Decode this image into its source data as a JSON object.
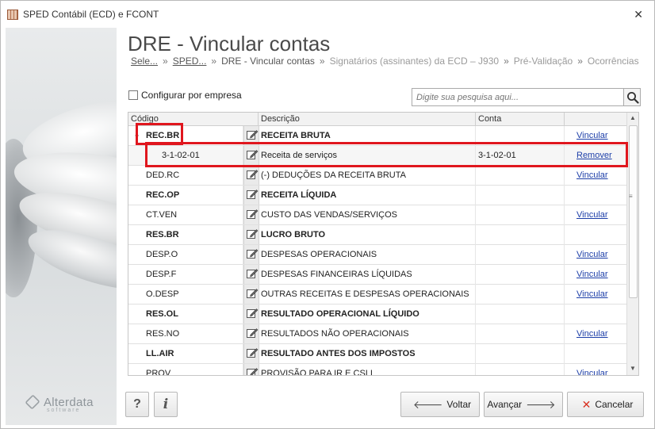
{
  "window": {
    "title": "SPED Contábil (ECD) e FCONT",
    "close_symbol": "✕"
  },
  "brand": {
    "name": "Alterdata",
    "tagline": "software"
  },
  "header": {
    "title": "DRE - Vincular contas",
    "breadcrumb": [
      {
        "label": "Sele...",
        "state": "link"
      },
      {
        "label": "SPED...",
        "state": "link"
      },
      {
        "label": "DRE - Vincular contas",
        "state": "current"
      },
      {
        "label": "Signatários (assinantes) da ECD – J930",
        "state": "future"
      },
      {
        "label": "Pré-Validação",
        "state": "future"
      },
      {
        "label": "Ocorrências",
        "state": "future"
      }
    ],
    "separator": "»"
  },
  "toolbar": {
    "config_checkbox_label": "Configurar por empresa",
    "config_checked": false,
    "search_placeholder": "Digite sua pesquisa aqui..."
  },
  "grid": {
    "columns": {
      "code": "Código",
      "description": "Descrição",
      "account": "Conta"
    },
    "rows": [
      {
        "code": "REC.BR",
        "description": "RECEITA BRUTA",
        "account": "",
        "action": "Vincular",
        "bold": true,
        "expanded": true,
        "expand_symbol": "⌄"
      },
      {
        "code": "3-1-02-01",
        "description": "Receita de serviços",
        "account": "3-1-02-01",
        "action": "Remover",
        "bold": false,
        "sub": true
      },
      {
        "code": "DED.RC",
        "description": "(-) DEDUÇÕES DA RECEITA BRUTA",
        "account": "",
        "action": "Vincular",
        "bold": false
      },
      {
        "code": "REC.OP",
        "description": "RECEITA LÍQUIDA",
        "account": "",
        "action": "",
        "bold": true
      },
      {
        "code": "CT.VEN",
        "description": "CUSTO DAS VENDAS/SERVIÇOS",
        "account": "",
        "action": "Vincular",
        "bold": false
      },
      {
        "code": "RES.BR",
        "description": "LUCRO BRUTO",
        "account": "",
        "action": "",
        "bold": true
      },
      {
        "code": "DESP.O",
        "description": "DESPESAS OPERACIONAIS",
        "account": "",
        "action": "Vincular",
        "bold": false
      },
      {
        "code": "DESP.F",
        "description": "DESPESAS FINANCEIRAS LÍQUIDAS",
        "account": "",
        "action": "Vincular",
        "bold": false
      },
      {
        "code": "O.DESP",
        "description": "OUTRAS RECEITAS E DESPESAS OPERACIONAIS",
        "account": "",
        "action": "Vincular",
        "bold": false
      },
      {
        "code": "RES.OL",
        "description": "RESULTADO OPERACIONAL LÍQUIDO",
        "account": "",
        "action": "",
        "bold": true
      },
      {
        "code": "RES.NO",
        "description": "RESULTADOS NÃO OPERACIONAIS",
        "account": "",
        "action": "Vincular",
        "bold": false
      },
      {
        "code": "LL.AIR",
        "description": "RESULTADO ANTES DOS IMPOSTOS",
        "account": "",
        "action": "",
        "bold": true
      },
      {
        "code": "PROV",
        "description": "PROVISÃO PARA IR E CSLL",
        "account": "",
        "action": "Vincular",
        "bold": false,
        "clipped": true
      }
    ],
    "scroll_up": "▲",
    "scroll_down": "▼",
    "scroll_grip": "≡"
  },
  "footer": {
    "help_label": "?",
    "info_label": "i",
    "back_label": "Voltar",
    "back_glyph": "🡐",
    "next_label": "Avançar",
    "next_glyph": "🡒",
    "cancel_label": "Cancelar",
    "cancel_glyph": "✕"
  },
  "colors": {
    "link": "#1c3ea8",
    "highlight": "#e0161e",
    "cancel_icon": "#d83020"
  }
}
